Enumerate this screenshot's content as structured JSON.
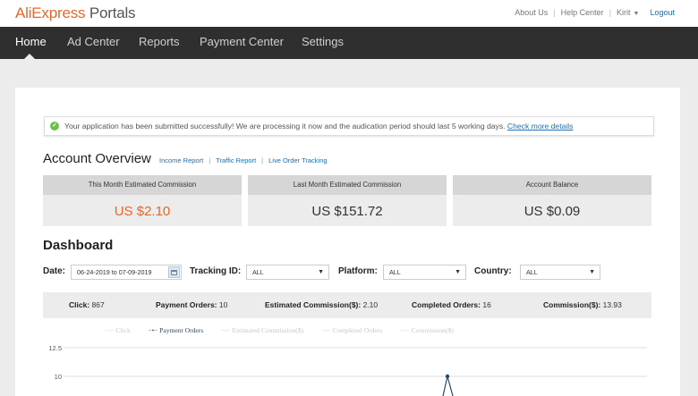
{
  "header": {
    "logo_brand": "AliExpress",
    "logo_product": "Portals",
    "links": {
      "about": "About Us",
      "help": "Help Center",
      "user": "Kirit",
      "logout": "Logout"
    }
  },
  "nav": {
    "items": [
      "Home",
      "Ad Center",
      "Reports",
      "Payment Center",
      "Settings"
    ],
    "active": "Home"
  },
  "notice": {
    "text": "Your application has been submitted successfully! We are processing it now and the audication period should last 5 working days.",
    "link": "Check more details"
  },
  "account": {
    "title": "Account Overview",
    "links": [
      "Income Report",
      "Traffic Report",
      "Live Order Tracking"
    ],
    "stats": [
      {
        "label": "This Month Estimated Commission",
        "value": "US $2.10"
      },
      {
        "label": "Last Month Estimated Commission",
        "value": "US $151.72"
      },
      {
        "label": "Account Balance",
        "value": "US $0.09"
      }
    ]
  },
  "dashboard": {
    "title": "Dashboard",
    "filters": {
      "date_label": "Date:",
      "date_value": "06-24-2019 to 07-09-2019",
      "tracking_label": "Tracking ID:",
      "tracking_value": "ALL",
      "platform_label": "Platform:",
      "platform_value": "ALL",
      "country_label": "Country:",
      "country_value": "ALL"
    },
    "totals": [
      {
        "label": "Click:",
        "value": "867"
      },
      {
        "label": "Payment Orders:",
        "value": "10"
      },
      {
        "label": "Estimated Commission($):",
        "value": "2.10"
      },
      {
        "label": "Completed Orders:",
        "value": "16"
      },
      {
        "label": "Commission($):",
        "value": "13.93"
      }
    ]
  },
  "chart_data": {
    "type": "line",
    "series": [
      {
        "name": "Click",
        "active": false
      },
      {
        "name": "Payment Orders",
        "active": true
      },
      {
        "name": "Estimated Commission($)",
        "active": false
      },
      {
        "name": "Completed Orders",
        "active": false
      },
      {
        "name": "Commission($)",
        "active": false
      }
    ],
    "y_ticks": [
      "12.5",
      "10"
    ],
    "visible_peak_value": 10,
    "colors": {
      "active": "#2a4a6a",
      "inactive": "#c8c8c8",
      "grid": "#dddddd"
    }
  }
}
